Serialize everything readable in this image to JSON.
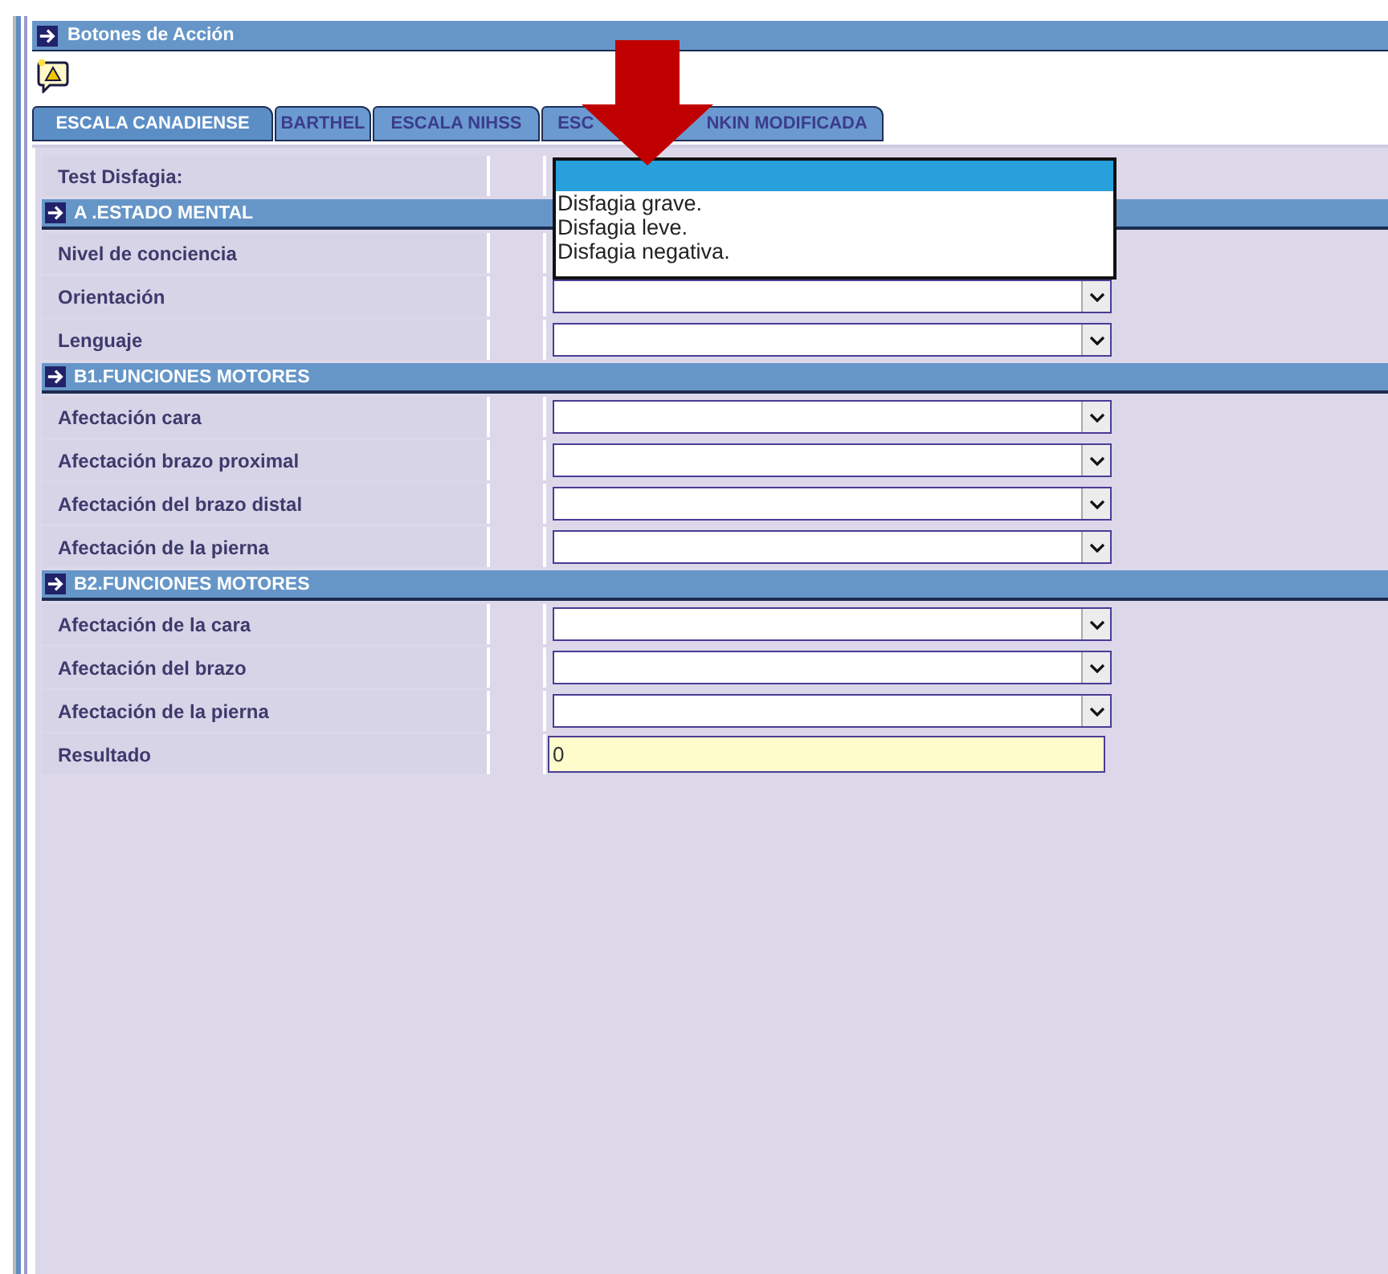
{
  "action_bar": {
    "title": "Botones de Acción"
  },
  "tabs": [
    {
      "label_parts": [
        "ESCALA CANADIENSE"
      ],
      "selected": true
    },
    {
      "label_parts": [
        "BARTHEL"
      ],
      "selected": false
    },
    {
      "label_parts": [
        "ESCALA NIHSS"
      ],
      "selected": false
    },
    {
      "label_parts": [
        "ESC",
        "NKIN MODIFICADA"
      ],
      "selected": false
    }
  ],
  "test_row": {
    "label": "Test Disfagia:",
    "dropdown": {
      "options": [
        {
          "selected": true
        },
        {
          "label": "Disfagia grave.",
          "selected": false
        },
        {
          "label": "Disfagia leve.",
          "selected": false
        },
        {
          "label": "Disfagia negativa.",
          "selected": false
        }
      ]
    }
  },
  "sections": [
    {
      "title": "A .ESTADO MENTAL",
      "rows": [
        {
          "label": "Nivel de conciencia"
        },
        {
          "label": "Orientación",
          "kind": "select"
        },
        {
          "label": "Lenguaje",
          "kind": "select"
        }
      ]
    },
    {
      "title": "B1.FUNCIONES MOTORES",
      "rows": [
        {
          "label": "Afectación cara",
          "kind": "select"
        },
        {
          "label": "Afectación brazo proximal",
          "kind": "select"
        },
        {
          "label": "Afectación del brazo distal",
          "kind": "select"
        },
        {
          "label": "Afectación de la pierna",
          "kind": "select"
        }
      ]
    },
    {
      "title": "B2.FUNCIONES MOTORES",
      "rows": [
        {
          "label": "Afectación de la cara",
          "kind": "select"
        },
        {
          "label": "Afectación del brazo",
          "kind": "select"
        },
        {
          "label": "Afectación de la pierna",
          "kind": "select"
        },
        {
          "label": "Resultado",
          "kind": "text",
          "value": "0"
        }
      ]
    }
  ]
}
